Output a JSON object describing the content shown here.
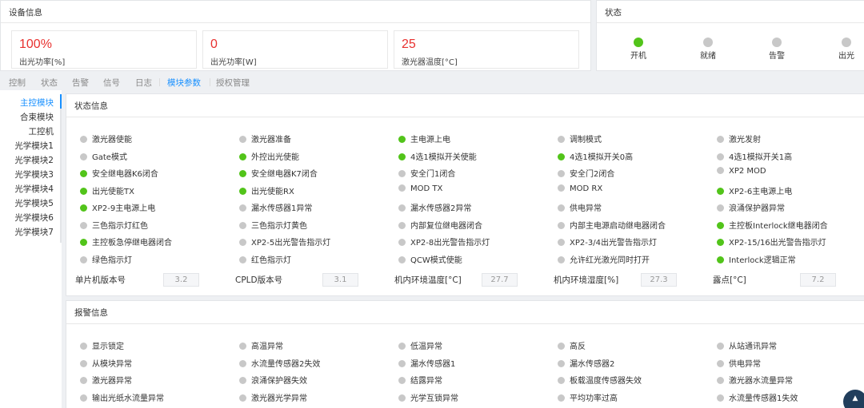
{
  "device_info": {
    "title": "设备信息",
    "metrics": [
      {
        "value": "100%",
        "label": "出光功率[%]"
      },
      {
        "value": "0",
        "label": "出光功率[W]"
      },
      {
        "value": "25",
        "label": "激光器温度[°C]"
      }
    ]
  },
  "status": {
    "title": "状态",
    "lamps": [
      {
        "label": "开机",
        "color": "#52c41a"
      },
      {
        "label": "就绪",
        "color": "#c8c8c8"
      },
      {
        "label": "告警",
        "color": "#c8c8c8"
      },
      {
        "label": "出光",
        "color": "#c8c8c8"
      }
    ]
  },
  "tabs": [
    "控制",
    "状态",
    "告警",
    "信号",
    "日志",
    "模块参数",
    "授权管理"
  ],
  "active_tab": "模块参数",
  "side_nav": [
    "主控模块",
    "合束模块",
    "工控机",
    "光学模块1",
    "光学模块2",
    "光学模块3",
    "光学模块4",
    "光学模块5",
    "光学模块6",
    "光学模块7"
  ],
  "active_nav": "主控模块",
  "state_info": {
    "title": "状态信息",
    "indicators": [
      {
        "label": "激光器使能",
        "on": false
      },
      {
        "label": "激光器准备",
        "on": false
      },
      {
        "label": "主电源上电",
        "on": true
      },
      {
        "label": "调制模式",
        "on": false
      },
      {
        "label": "激光发射",
        "on": false
      },
      {
        "label": "Gate模式",
        "on": false
      },
      {
        "label": "外控出光使能",
        "on": true
      },
      {
        "label": "4选1模拟开关使能",
        "on": true
      },
      {
        "label": "4选1模拟开关0高",
        "on": true
      },
      {
        "label": "4选1模拟开关1高",
        "on": false
      },
      {
        "label": "安全继电器K6闭合",
        "on": true
      },
      {
        "label": "安全继电器K7闭合",
        "on": true
      },
      {
        "label": "安全门1闭合",
        "on": false
      },
      {
        "label": "安全门2闭合",
        "on": false
      },
      {
        "label": "XP2 MOD",
        "on": false
      },
      {
        "label": "出光使能TX",
        "on": true
      },
      {
        "label": "出光使能RX",
        "on": true
      },
      {
        "label": "MOD TX",
        "on": false
      },
      {
        "label": "MOD RX",
        "on": false
      },
      {
        "label": "XP2-6主电源上电",
        "on": true
      },
      {
        "label": "XP2-9主电源上电",
        "on": true
      },
      {
        "label": "漏水传感器1异常",
        "on": false
      },
      {
        "label": "漏水传感器2异常",
        "on": false
      },
      {
        "label": "供电异常",
        "on": false
      },
      {
        "label": "浪涌保护器异常",
        "on": false
      },
      {
        "label": "三色指示灯红色",
        "on": false
      },
      {
        "label": "三色指示灯黄色",
        "on": false
      },
      {
        "label": "内部复位继电器闭合",
        "on": false
      },
      {
        "label": "内部主电源启动继电器闭合",
        "on": false
      },
      {
        "label": "主控板Interlock继电器闭合",
        "on": true
      },
      {
        "label": "主控板急停继电器闭合",
        "on": true
      },
      {
        "label": "XP2-5出光警告指示灯",
        "on": false
      },
      {
        "label": "XP2-8出光警告指示灯",
        "on": false
      },
      {
        "label": "XP2-3/4出光警告指示灯",
        "on": false
      },
      {
        "label": "XP2-15/16出光警告指示灯",
        "on": true
      },
      {
        "label": "绿色指示灯",
        "on": false
      },
      {
        "label": "红色指示灯",
        "on": false
      },
      {
        "label": "QCW模式使能",
        "on": false
      },
      {
        "label": "允许红光激光同时打开",
        "on": false
      },
      {
        "label": "Interlock逻辑正常",
        "on": true
      }
    ],
    "versions": [
      {
        "label": "单片机版本号",
        "value": "3.2"
      },
      {
        "label": "CPLD版本号",
        "value": "3.1"
      },
      {
        "label": "机内环境温度[°C]",
        "value": "27.7"
      },
      {
        "label": "机内环境湿度[%]",
        "value": "27.3"
      },
      {
        "label": "露点[°C]",
        "value": "7.2"
      }
    ]
  },
  "alarm_info": {
    "title": "报警信息",
    "indicators": [
      {
        "label": "显示锁定",
        "on": false
      },
      {
        "label": "高温异常",
        "on": false
      },
      {
        "label": "低温异常",
        "on": false
      },
      {
        "label": "高反",
        "on": false
      },
      {
        "label": "从站通讯异常",
        "on": false
      },
      {
        "label": "从模块异常",
        "on": false
      },
      {
        "label": "水流量传感器2失效",
        "on": false
      },
      {
        "label": "漏水传感器1",
        "on": false
      },
      {
        "label": "漏水传感器2",
        "on": false
      },
      {
        "label": "供电异常",
        "on": false
      },
      {
        "label": "激光器异常",
        "on": false
      },
      {
        "label": "浪涌保护器失效",
        "on": false
      },
      {
        "label": "结露异常",
        "on": false
      },
      {
        "label": "板载温度传感器失效",
        "on": false
      },
      {
        "label": "激光器水流量异常",
        "on": false
      },
      {
        "label": "输出光纸水流量异常",
        "on": false
      },
      {
        "label": "激光器光学异常",
        "on": false
      },
      {
        "label": "光学互锁异常",
        "on": false
      },
      {
        "label": "平均功率过高",
        "on": false
      },
      {
        "label": "水流量传感器1失效",
        "on": false
      }
    ]
  },
  "colors": {
    "accent": "#1890ff",
    "on": "#52c41a",
    "off": "#c8c8c8",
    "metric_value": "#e8312f"
  }
}
